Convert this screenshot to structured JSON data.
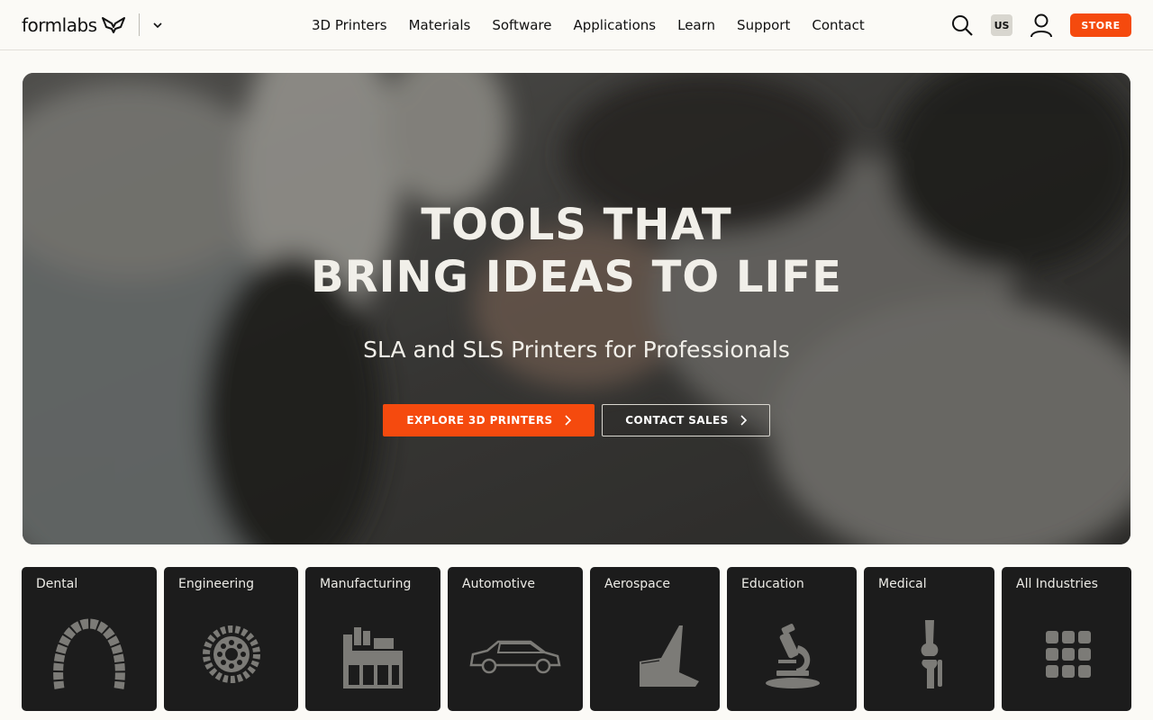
{
  "header": {
    "logo": "formlabs",
    "nav": [
      "3D Printers",
      "Materials",
      "Software",
      "Applications",
      "Learn",
      "Support",
      "Contact"
    ],
    "locale": "US",
    "store_label": "STORE"
  },
  "hero": {
    "title_line1": "TOOLS THAT",
    "title_line2": "BRING IDEAS TO LIFE",
    "subtitle": "SLA and SLS Printers for Professionals",
    "primary_cta": "EXPLORE 3D PRINTERS",
    "secondary_cta": "CONTACT SALES"
  },
  "industries": [
    {
      "label": "Dental",
      "icon": "dental-arch-icon"
    },
    {
      "label": "Engineering",
      "icon": "gear-icon"
    },
    {
      "label": "Manufacturing",
      "icon": "factory-icon"
    },
    {
      "label": "Automotive",
      "icon": "car-icon"
    },
    {
      "label": "Aerospace",
      "icon": "airplane-tail-icon"
    },
    {
      "label": "Education",
      "icon": "microscope-icon"
    },
    {
      "label": "Medical",
      "icon": "knee-joint-icon"
    },
    {
      "label": "All Industries",
      "icon": "grid-icon"
    }
  ],
  "colors": {
    "accent": "#f54a0e",
    "card_bg": "#1c1c1c",
    "page_bg": "#fbfaf6"
  }
}
